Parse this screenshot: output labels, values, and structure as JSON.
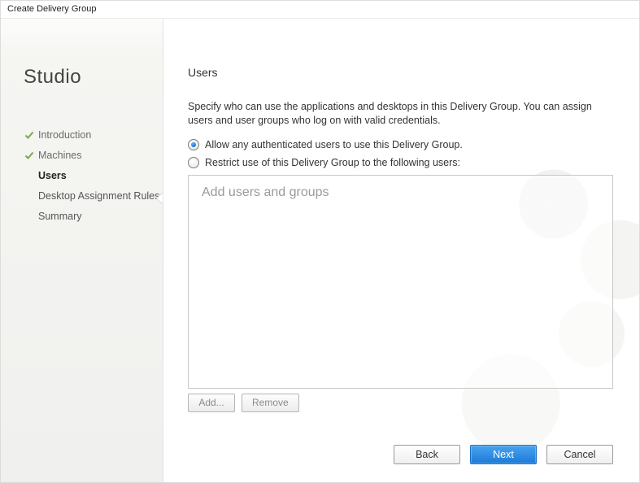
{
  "window": {
    "title": "Create Delivery Group"
  },
  "sidebar": {
    "brand": "Studio",
    "items": [
      {
        "label": "Introduction",
        "state": "completed"
      },
      {
        "label": "Machines",
        "state": "completed"
      },
      {
        "label": "Users",
        "state": "current"
      },
      {
        "label": "Desktop Assignment Rules",
        "state": "upcoming"
      },
      {
        "label": "Summary",
        "state": "upcoming"
      }
    ]
  },
  "page": {
    "heading": "Users",
    "instruction": "Specify who can use the applications and desktops in this Delivery Group. You can assign users and user groups who log on with valid credentials.",
    "radios": {
      "allow_any": "Allow any authenticated users to use this Delivery Group.",
      "restrict": "Restrict use of this Delivery Group to the following users:"
    },
    "list_placeholder": "Add users and groups",
    "buttons": {
      "add": "Add...",
      "remove": "Remove"
    }
  },
  "footer": {
    "back": "Back",
    "next": "Next",
    "cancel": "Cancel"
  }
}
